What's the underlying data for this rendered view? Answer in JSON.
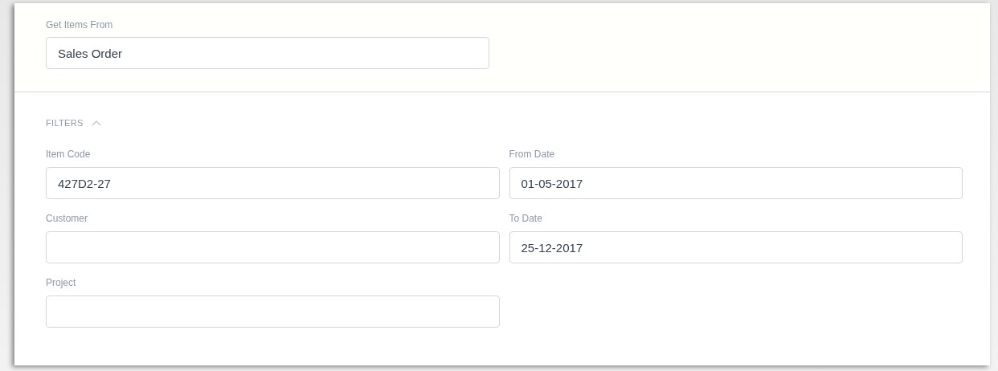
{
  "source": {
    "label": "Get Items From",
    "value": "Sales Order"
  },
  "filters": {
    "title": "FILTERS",
    "expanded": true,
    "columns": [
      [
        {
          "label": "Item Code",
          "value": "427D2-27"
        },
        {
          "label": "Customer"
        },
        {
          "label": "Project"
        }
      ],
      [
        {
          "label": "From Date",
          "value": "01-05-2017"
        },
        {
          "label": "To Date",
          "value": "25-12-2017"
        }
      ]
    ]
  }
}
